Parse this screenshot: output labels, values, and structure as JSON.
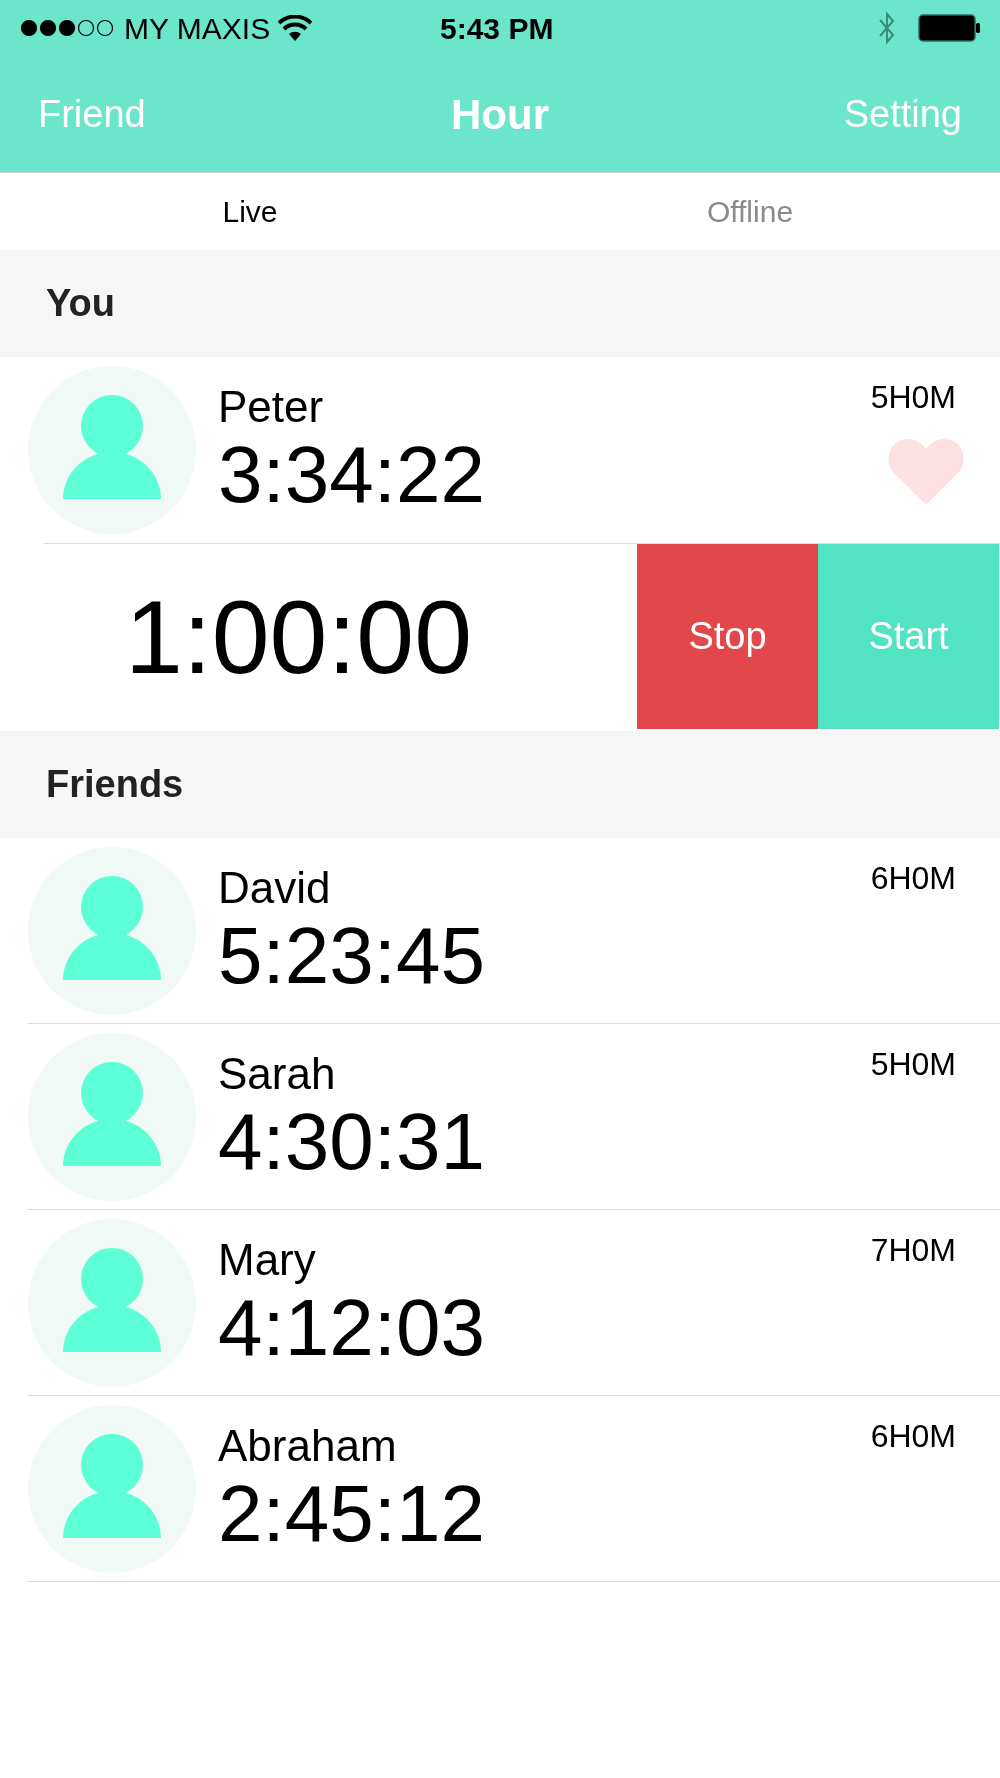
{
  "status_bar": {
    "carrier": "MY MAXIS",
    "time": "5:43 PM"
  },
  "nav": {
    "left": "Friend",
    "title": "Hour",
    "right": "Setting"
  },
  "tabs": [
    {
      "label": "Live",
      "selected": true
    },
    {
      "label": "Offline",
      "selected": false
    }
  ],
  "you": {
    "heading": "You",
    "person": {
      "name": "Peter",
      "elapsed": "3:34:22",
      "goal": "5H0M",
      "favorite": false
    },
    "timer": {
      "value": "1:00:00",
      "buttons": [
        {
          "label": "Stop",
          "kind": "stop"
        },
        {
          "label": "Start",
          "kind": "start"
        }
      ]
    }
  },
  "friends": {
    "heading": "Friends",
    "people": [
      {
        "name": "David",
        "elapsed": "5:23:45",
        "goal": "6H0M"
      },
      {
        "name": "Sarah",
        "elapsed": "4:30:31",
        "goal": "5H0M"
      },
      {
        "name": "Mary",
        "elapsed": "4:12:03",
        "goal": "7H0M"
      },
      {
        "name": "Abraham",
        "elapsed": "2:45:12",
        "goal": "6H0M"
      }
    ]
  }
}
